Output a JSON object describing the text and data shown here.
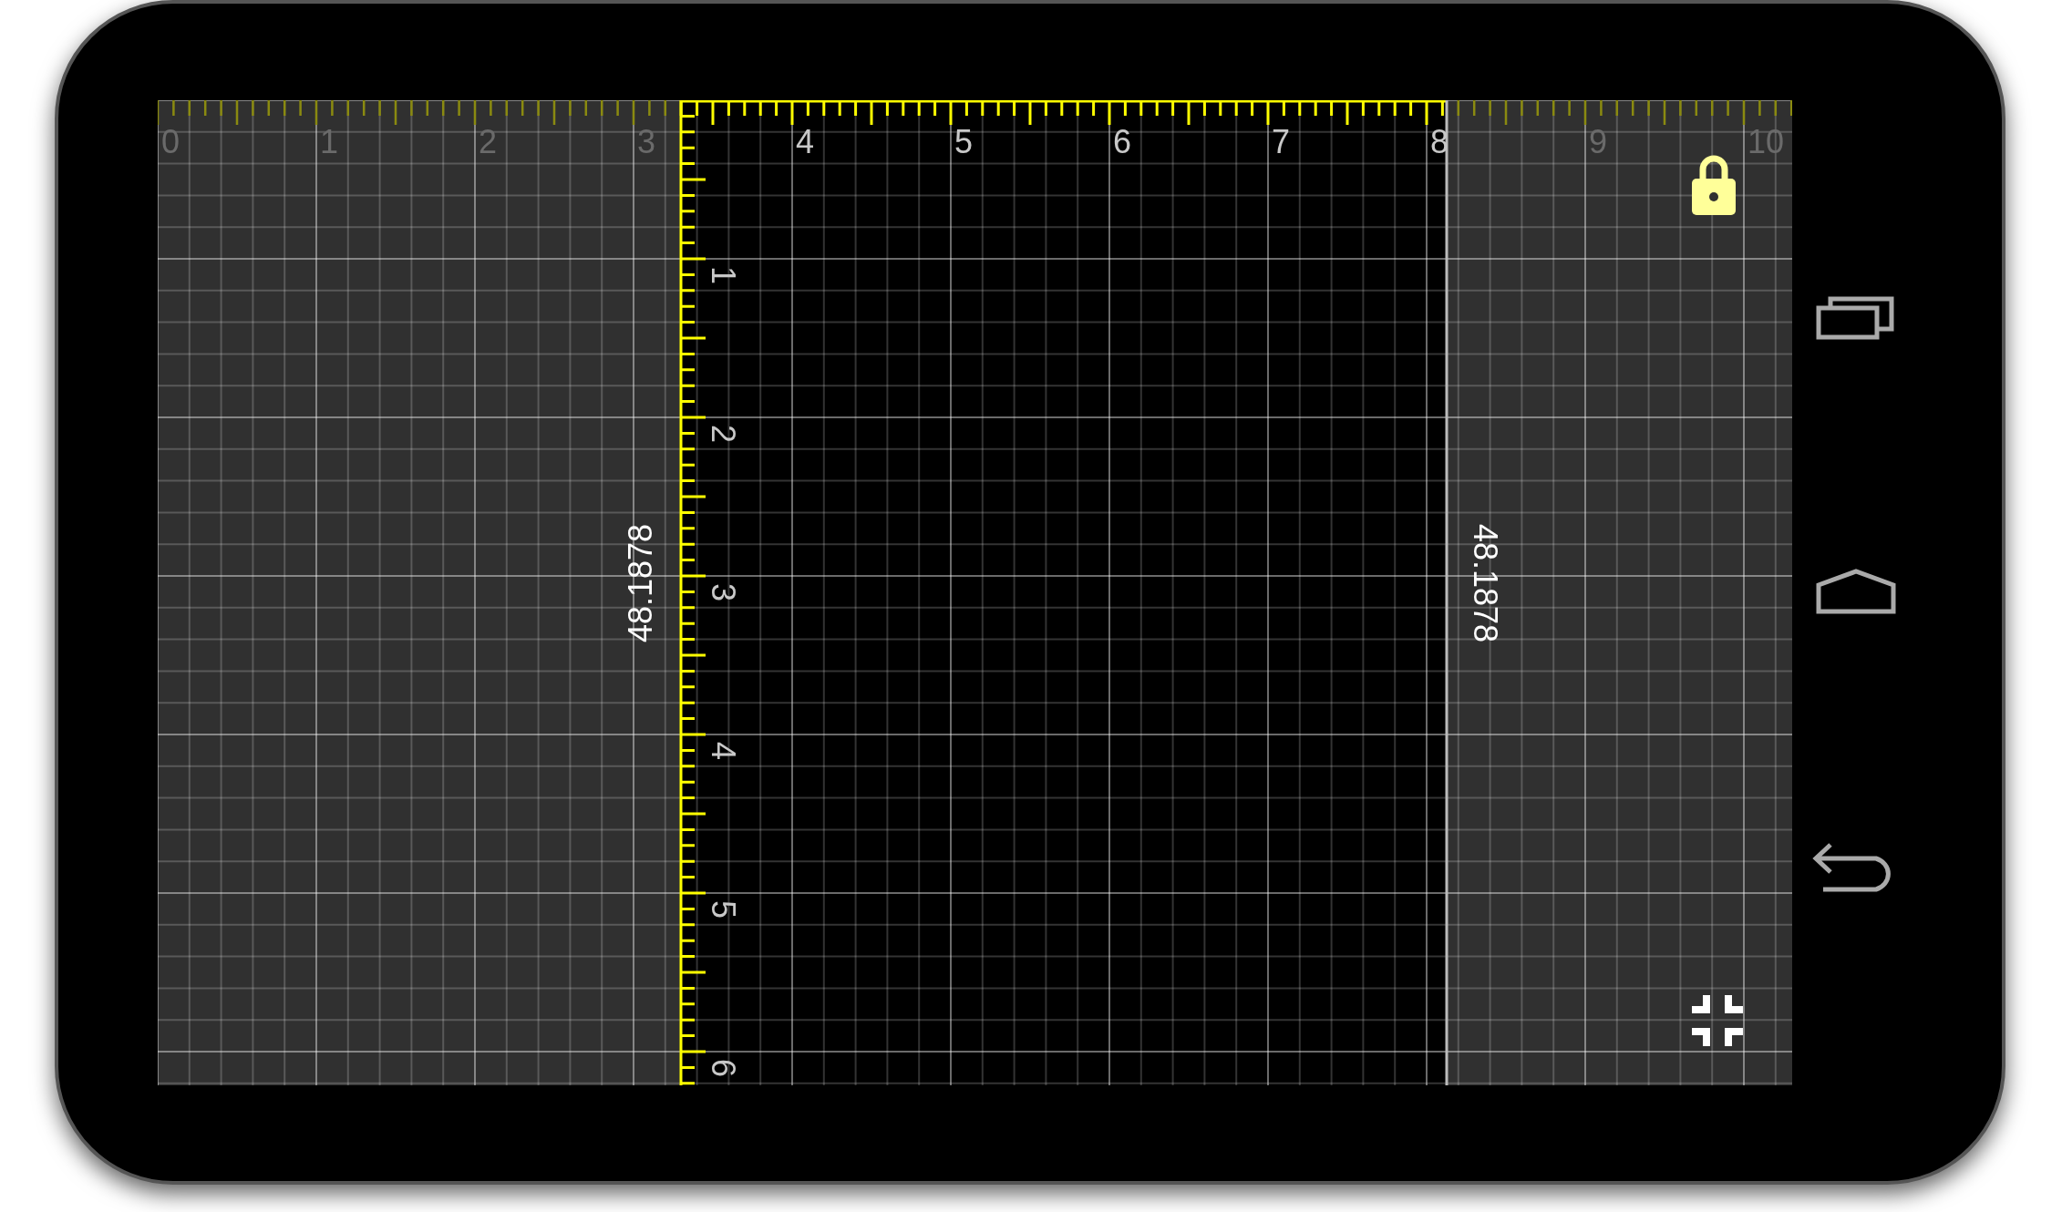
{
  "top_ruler": {
    "labels": [
      "0",
      "1",
      "2",
      "3",
      "4",
      "5",
      "6",
      "7",
      "8",
      "9",
      "10"
    ]
  },
  "side_ruler": {
    "labels": [
      "1",
      "2",
      "3",
      "4",
      "5",
      "6"
    ]
  },
  "measurements": [
    {
      "value": "48.1878"
    },
    {
      "value": "48.1878"
    }
  ]
}
